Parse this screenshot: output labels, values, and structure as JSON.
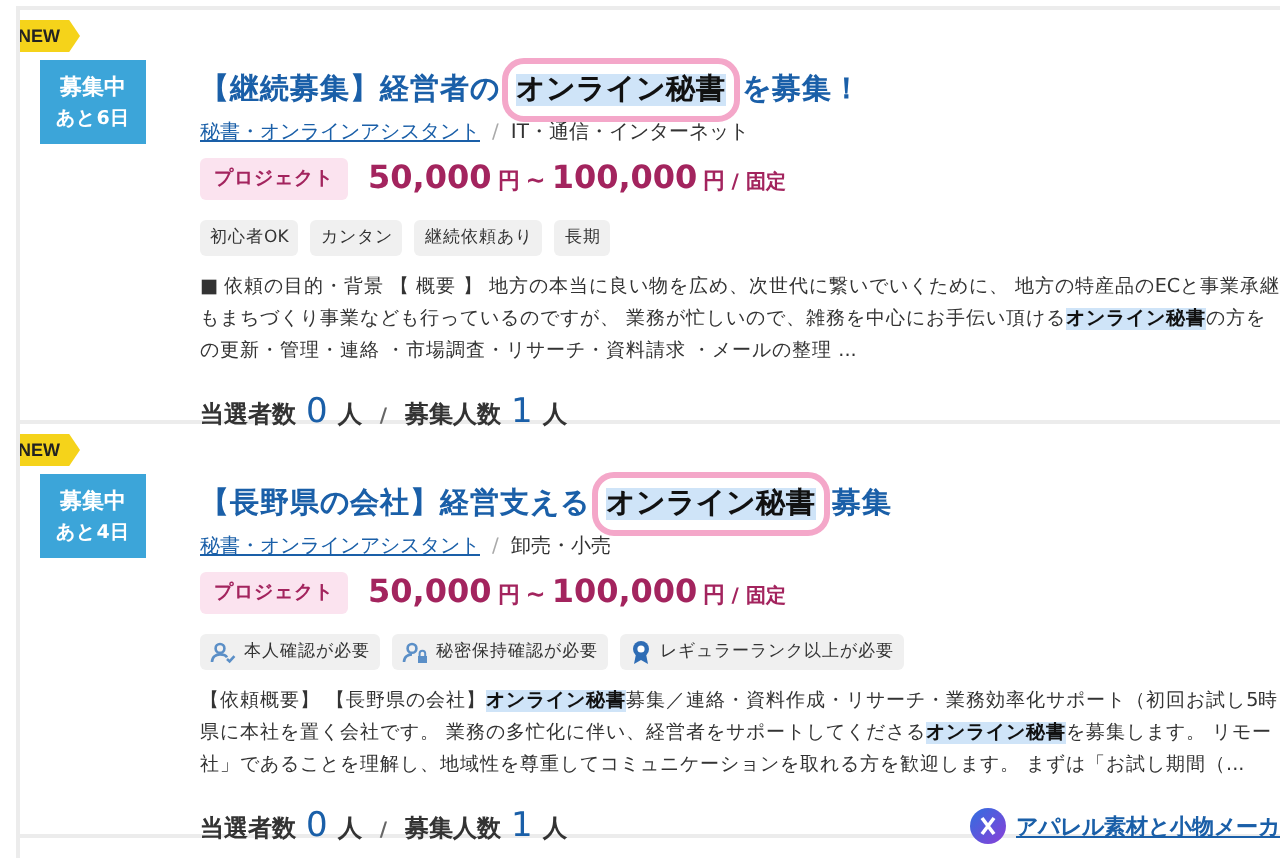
{
  "jobs": [
    {
      "is_new": true,
      "new_label": "NEW",
      "status": "募集中",
      "remaining": "あと6日",
      "title": "【継続募集】経営者の**オンライン秘書**を募集！",
      "category": "秘書・オンラインアシスタント",
      "separator": "/",
      "industry": "IT・通信・インターネット",
      "type_badge": "プロジェクト",
      "price_min": "50,000",
      "price_max": "100,000",
      "currency_1": "円",
      "range_mark": "~",
      "currency_2": "円",
      "price_type": "/ 固定",
      "tags": [
        {
          "kind": "plain",
          "label": "初心者OK"
        },
        {
          "kind": "plain",
          "label": "カンタン"
        },
        {
          "kind": "plain",
          "label": "継続依頼あり"
        },
        {
          "kind": "plain",
          "label": "長期"
        }
      ],
      "description": [
        "■ 依頼の目的・背景 【 概要 】 地方の本当に良い物を広め、次世代に繋いでいくために、 地方の特産品のECと事業承継",
        "もまちづくり事業なども行っているのですが、 業務が忙しいので、雑務を中心にお手伝い頂ける**オンライン秘書**の方を",
        "の更新・管理・連絡 ・市場調査・リサーチ・資料請求 ・メールの整理 ..."
      ],
      "winners_label": "当選者数",
      "winners": "0",
      "winners_unit": "人",
      "slash": "/",
      "openings_label": "募集人数",
      "openings": "1",
      "openings_unit": "人"
    },
    {
      "is_new": true,
      "new_label": "NEW",
      "status": "募集中",
      "remaining": "あと4日",
      "title": "【長野県の会社】経営支える**オンライン秘書**募集",
      "category": "秘書・オンラインアシスタント",
      "separator": "/",
      "industry": "卸売・小売",
      "type_badge": "プロジェクト",
      "price_min": "50,000",
      "price_max": "100,000",
      "currency_1": "円",
      "range_mark": "~",
      "currency_2": "円",
      "price_type": "/ 固定",
      "tags": [
        {
          "kind": "identity",
          "label": "本人確認が必要"
        },
        {
          "kind": "confidentiality",
          "label": "秘密保持確認が必要"
        },
        {
          "kind": "rank",
          "label": "レギュラーランク以上が必要"
        }
      ],
      "description": [
        "【依頼概要】 【長野県の会社】**オンライン秘書**募集／連絡・資料作成・リサーチ・業務効率化サポート（初回お試し5時",
        "県に本社を置く会社です。 業務の多忙化に伴い、経営者をサポートしてくださる**オンライン秘書**を募集します。 リモー",
        "社」であることを理解し、地域性を尊重してコミュニケーションを取れる方を歓迎します。 まずは「お試し期間（..."
      ],
      "winners_label": "当選者数",
      "winners": "0",
      "winners_unit": "人",
      "slash": "/",
      "openings_label": "募集人数",
      "openings": "1",
      "openings_unit": "人",
      "client_link": "アパレル素材と小物メーカ"
    }
  ]
}
